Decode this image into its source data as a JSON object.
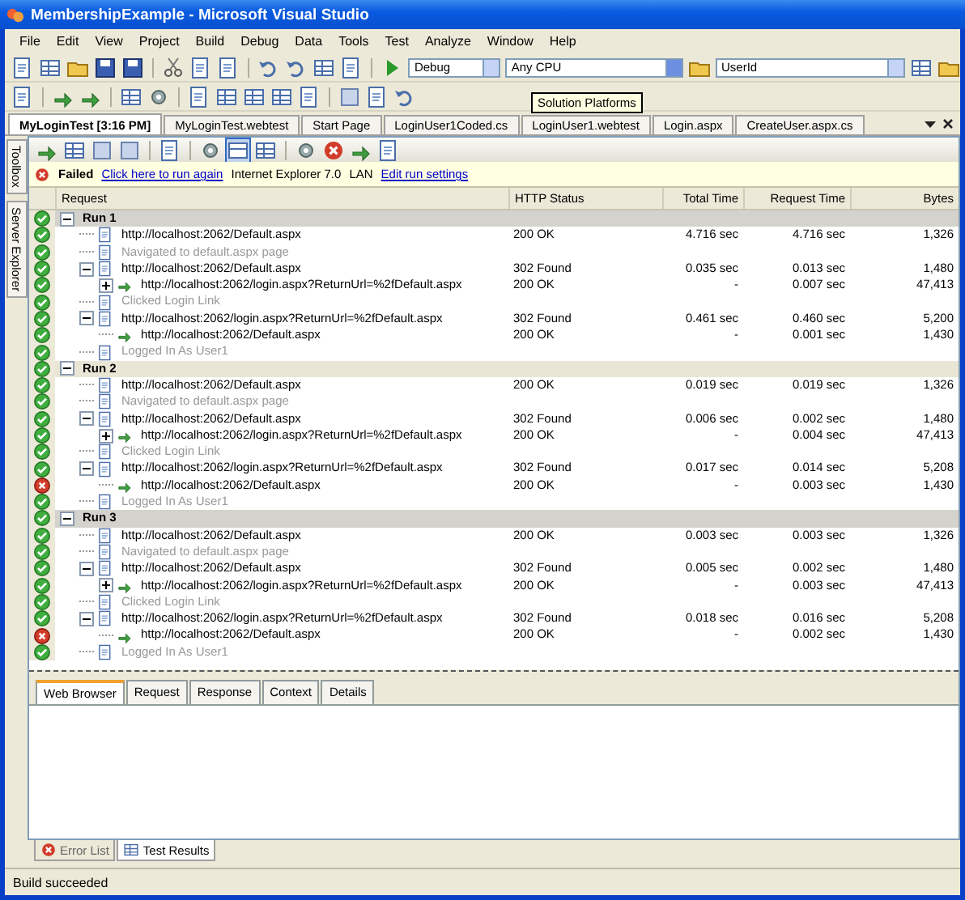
{
  "window": {
    "title": "MembershipExample - Microsoft Visual Studio"
  },
  "menu": [
    "File",
    "Edit",
    "View",
    "Project",
    "Build",
    "Debug",
    "Data",
    "Tools",
    "Test",
    "Analyze",
    "Window",
    "Help"
  ],
  "toolbar": {
    "configuration": "Debug",
    "platform": "Any CPU",
    "find": "UserId"
  },
  "tooltip": "Solution Platforms",
  "document_tabs": [
    {
      "label": "MyLoginTest [3:16 PM]",
      "selected": true
    },
    {
      "label": "MyLoginTest.webtest",
      "selected": false
    },
    {
      "label": "Start Page",
      "selected": false
    },
    {
      "label": "LoginUser1Coded.cs",
      "selected": false
    },
    {
      "label": "LoginUser1.webtest",
      "selected": false
    },
    {
      "label": "Login.aspx",
      "selected": false
    },
    {
      "label": "CreateUser.aspx.cs",
      "selected": false
    }
  ],
  "side_tabs": [
    "Toolbox",
    "Server Explorer"
  ],
  "result_bar": {
    "status": "Failed",
    "passed": false,
    "run_again_link": "Click here to run again",
    "browser": "Internet Explorer 7.0",
    "network": "LAN",
    "settings_link": "Edit run settings"
  },
  "columns": [
    "Request",
    "HTTP Status",
    "Total Time",
    "Request Time",
    "Bytes"
  ],
  "runs": [
    {
      "label": "Run 1",
      "passed": true,
      "expanded": true,
      "children": [
        {
          "kind": "request",
          "url": "http://localhost:2062/Default.aspx",
          "status": "200 OK",
          "total_time": "4.716 sec",
          "request_time": "4.716 sec",
          "bytes": "1,326",
          "passed": true
        },
        {
          "kind": "comment",
          "text": "Navigated to default.aspx page",
          "passed": true
        },
        {
          "kind": "request",
          "url": "http://localhost:2062/Default.aspx",
          "status": "302 Found",
          "total_time": "0.035 sec",
          "request_time": "0.013 sec",
          "bytes": "1,480",
          "passed": true,
          "expanded": true,
          "children": [
            {
              "kind": "redirect",
              "url": "http://localhost:2062/login.aspx?ReturnUrl=%2fDefault.aspx",
              "status": "200 OK",
              "total_time": "-",
              "request_time": "0.007 sec",
              "bytes": "47,413",
              "passed": true,
              "expanded": false
            }
          ]
        },
        {
          "kind": "comment",
          "text": "Clicked Login Link",
          "passed": true
        },
        {
          "kind": "request",
          "url": "http://localhost:2062/login.aspx?ReturnUrl=%2fDefault.aspx",
          "status": "302 Found",
          "total_time": "0.461 sec",
          "request_time": "0.460 sec",
          "bytes": "5,200",
          "passed": true,
          "expanded": true,
          "children": [
            {
              "kind": "redirect",
              "url": "http://localhost:2062/Default.aspx",
              "status": "200 OK",
              "total_time": "-",
              "request_time": "0.001 sec",
              "bytes": "1,430",
              "passed": true
            }
          ]
        },
        {
          "kind": "comment",
          "text": "Logged In As User1",
          "passed": true
        }
      ]
    },
    {
      "label": "Run 2",
      "passed": true,
      "expanded": true,
      "children": [
        {
          "kind": "request",
          "url": "http://localhost:2062/Default.aspx",
          "status": "200 OK",
          "total_time": "0.019 sec",
          "request_time": "0.019 sec",
          "bytes": "1,326",
          "passed": true
        },
        {
          "kind": "comment",
          "text": "Navigated to default.aspx page",
          "passed": true
        },
        {
          "kind": "request",
          "url": "http://localhost:2062/Default.aspx",
          "status": "302 Found",
          "total_time": "0.006 sec",
          "request_time": "0.002 sec",
          "bytes": "1,480",
          "passed": true,
          "expanded": true,
          "children": [
            {
              "kind": "redirect",
              "url": "http://localhost:2062/login.aspx?ReturnUrl=%2fDefault.aspx",
              "status": "200 OK",
              "total_time": "-",
              "request_time": "0.004 sec",
              "bytes": "47,413",
              "passed": true,
              "expanded": false
            }
          ]
        },
        {
          "kind": "comment",
          "text": "Clicked Login Link",
          "passed": true
        },
        {
          "kind": "request",
          "url": "http://localhost:2062/login.aspx?ReturnUrl=%2fDefault.aspx",
          "status": "302 Found",
          "total_time": "0.017 sec",
          "request_time": "0.014 sec",
          "bytes": "5,208",
          "passed": true,
          "expanded": true,
          "children": [
            {
              "kind": "redirect",
              "url": "http://localhost:2062/Default.aspx",
              "status": "200 OK",
              "total_time": "-",
              "request_time": "0.003 sec",
              "bytes": "1,430",
              "passed": false
            }
          ]
        },
        {
          "kind": "comment",
          "text": "Logged In As User1",
          "passed": true
        }
      ]
    },
    {
      "label": "Run 3",
      "passed": true,
      "expanded": true,
      "children": [
        {
          "kind": "request",
          "url": "http://localhost:2062/Default.aspx",
          "status": "200 OK",
          "total_time": "0.003 sec",
          "request_time": "0.003 sec",
          "bytes": "1,326",
          "passed": true
        },
        {
          "kind": "comment",
          "text": "Navigated to default.aspx page",
          "passed": true
        },
        {
          "kind": "request",
          "url": "http://localhost:2062/Default.aspx",
          "status": "302 Found",
          "total_time": "0.005 sec",
          "request_time": "0.002 sec",
          "bytes": "1,480",
          "passed": true,
          "expanded": true,
          "children": [
            {
              "kind": "redirect",
              "url": "http://localhost:2062/login.aspx?ReturnUrl=%2fDefault.aspx",
              "status": "200 OK",
              "total_time": "-",
              "request_time": "0.003 sec",
              "bytes": "47,413",
              "passed": true,
              "expanded": false
            }
          ]
        },
        {
          "kind": "comment",
          "text": "Clicked Login Link",
          "passed": true
        },
        {
          "kind": "request",
          "url": "http://localhost:2062/login.aspx?ReturnUrl=%2fDefault.aspx",
          "status": "302 Found",
          "total_time": "0.018 sec",
          "request_time": "0.016 sec",
          "bytes": "5,208",
          "passed": true,
          "expanded": true,
          "children": [
            {
              "kind": "redirect",
              "url": "http://localhost:2062/Default.aspx",
              "status": "200 OK",
              "total_time": "-",
              "request_time": "0.002 sec",
              "bytes": "1,430",
              "passed": false
            }
          ]
        },
        {
          "kind": "comment",
          "text": "Logged In As User1",
          "passed": true
        }
      ]
    }
  ],
  "detail_tabs": [
    {
      "label": "Web Browser",
      "selected": true
    },
    {
      "label": "Request",
      "selected": false
    },
    {
      "label": "Response",
      "selected": false
    },
    {
      "label": "Context",
      "selected": false
    },
    {
      "label": "Details",
      "selected": false
    }
  ],
  "tool_tabs": [
    {
      "label": "Error List",
      "selected": false
    },
    {
      "label": "Test Results",
      "selected": true
    }
  ],
  "status_bar": "Build succeeded"
}
